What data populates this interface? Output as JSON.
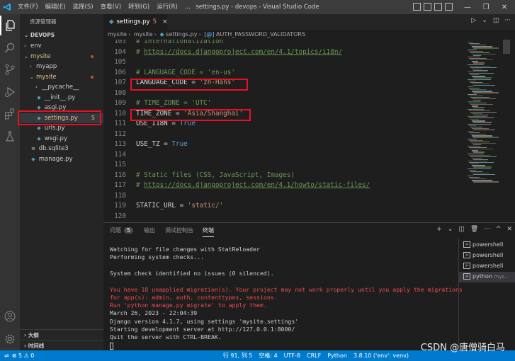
{
  "titlebar": {
    "menu": [
      "文件(F)",
      "编辑(E)",
      "选择(S)",
      "查看(V)",
      "转到(G)",
      "运行(R)",
      "..."
    ],
    "title": "settings.py - devops - Visual Studio Code",
    "controls": {
      "minimize": "—",
      "restore": "❐",
      "close": "✕"
    }
  },
  "activitybar": {
    "items": [
      "files-icon",
      "search-icon",
      "source-control-icon",
      "run-debug-icon",
      "extensions-icon",
      "testing-icon",
      "account-icon",
      "manage-gear-icon"
    ]
  },
  "sidebar": {
    "title": "资源管理器",
    "root": "DEVOPS",
    "tree": [
      {
        "label": "env",
        "type": "folder",
        "collapsed": true,
        "level": 1
      },
      {
        "label": "mysite",
        "type": "folder",
        "collapsed": false,
        "level": 1,
        "modified": true
      },
      {
        "label": "myapp",
        "type": "folder",
        "collapsed": true,
        "level": 2
      },
      {
        "label": "mysite",
        "type": "folder",
        "collapsed": false,
        "level": 2,
        "modified": true
      },
      {
        "label": "__pycache__",
        "type": "folder",
        "collapsed": true,
        "level": 3
      },
      {
        "label": "__init__.py",
        "type": "py",
        "level": 3
      },
      {
        "label": "asgi.py",
        "type": "py",
        "level": 3
      },
      {
        "label": "settings.py",
        "type": "py",
        "level": 3,
        "badge": "5",
        "selected": true
      },
      {
        "label": "urls.py",
        "type": "py",
        "level": 3
      },
      {
        "label": "wsgi.py",
        "type": "py",
        "level": 3
      },
      {
        "label": "db.sqlite3",
        "type": "db",
        "level": 2
      },
      {
        "label": "manage.py",
        "type": "py",
        "level": 2
      }
    ],
    "outline_label": "大纲",
    "timeline_label": "时间线"
  },
  "editor": {
    "tab": {
      "label": "settings.py",
      "problems": "5",
      "close": "×"
    },
    "breadcrumb": [
      "mysite",
      "mysite",
      "settings.py",
      "AUTH_PASSWORD_VALIDATORS"
    ],
    "lines": [
      {
        "n": "103",
        "tokens": [
          {
            "t": "# Internationalization",
            "c": "comment"
          }
        ]
      },
      {
        "n": "104",
        "tokens": [
          {
            "t": "# ",
            "c": "comment"
          },
          {
            "t": "https://docs.djangoproject.com/en/4.1/topics/i18n/",
            "c": "link"
          }
        ]
      },
      {
        "n": "105",
        "tokens": []
      },
      {
        "n": "106",
        "tokens": [
          {
            "t": "# LANGUAGE_CODE = 'en-us'",
            "c": "comment"
          }
        ]
      },
      {
        "n": "107",
        "tokens": [
          {
            "t": "LANGUAGE_CODE",
            "c": "var"
          },
          {
            "t": " = ",
            "c": "var"
          },
          {
            "t": "'zh-Hans'",
            "c": "str"
          }
        ]
      },
      {
        "n": "108",
        "tokens": []
      },
      {
        "n": "109",
        "tokens": [
          {
            "t": "# TIME_ZONE = 'UTC'",
            "c": "comment"
          }
        ]
      },
      {
        "n": "110",
        "tokens": [
          {
            "t": "TIME_ZONE",
            "c": "var"
          },
          {
            "t": " = ",
            "c": "var"
          },
          {
            "t": "'Asia/Shanghai'",
            "c": "str"
          }
        ]
      },
      {
        "n": "111",
        "tokens": [
          {
            "t": "USE_I18N",
            "c": "var"
          },
          {
            "t": " = ",
            "c": "var"
          },
          {
            "t": "True",
            "c": "kw"
          }
        ]
      },
      {
        "n": "112",
        "tokens": []
      },
      {
        "n": "113",
        "tokens": [
          {
            "t": "USE_TZ",
            "c": "var"
          },
          {
            "t": " = ",
            "c": "var"
          },
          {
            "t": "True",
            "c": "kw"
          }
        ]
      },
      {
        "n": "114",
        "tokens": []
      },
      {
        "n": "115",
        "tokens": []
      },
      {
        "n": "116",
        "tokens": [
          {
            "t": "# Static files (CSS, JavaScript, Images)",
            "c": "comment"
          }
        ]
      },
      {
        "n": "117",
        "tokens": [
          {
            "t": "# ",
            "c": "comment"
          },
          {
            "t": "https://docs.djangoproject.com/en/4.1/howto/static-files/",
            "c": "link"
          }
        ]
      },
      {
        "n": "118",
        "tokens": []
      },
      {
        "n": "119",
        "tokens": [
          {
            "t": "STATIC_URL",
            "c": "var"
          },
          {
            "t": " = ",
            "c": "var"
          },
          {
            "t": "'static/'",
            "c": "str"
          }
        ]
      },
      {
        "n": "120",
        "tokens": []
      }
    ]
  },
  "panel": {
    "tabs": [
      {
        "label": "问题",
        "count": "5"
      },
      {
        "label": "输出"
      },
      {
        "label": "调试控制台"
      },
      {
        "label": "终端",
        "active": true
      }
    ],
    "terminal_lines": [
      {
        "text": "Watching for file changes with StatReloader",
        "err": false
      },
      {
        "text": "Performing system checks...",
        "err": false
      },
      {
        "text": "",
        "err": false
      },
      {
        "text": "System check identified no issues (0 silenced).",
        "err": false
      },
      {
        "text": "",
        "err": false
      },
      {
        "text": "You have 18 unapplied migration(s). Your project may not work properly until you apply the migrations",
        "err": true
      },
      {
        "text": "for app(s): admin, auth, contenttypes, sessions.",
        "err": true
      },
      {
        "text": "Run 'python manage.py migrate' to apply them.",
        "err": true
      },
      {
        "text": "March 26, 2023 - 22:04:39",
        "err": false
      },
      {
        "text": "Django version 4.1.7, using settings 'mysite.settings'",
        "err": false
      },
      {
        "text": "Starting development server at http://127.0.0.1:8000/",
        "err": false
      },
      {
        "text": "Quit the server with CTRL-BREAK.",
        "err": false
      }
    ],
    "terminals": [
      {
        "label": "powershell",
        "sub": ""
      },
      {
        "label": "powershell",
        "sub": ""
      },
      {
        "label": "powershell",
        "sub": ""
      },
      {
        "label": "python",
        "sub": "mys...",
        "active": true
      }
    ]
  },
  "statusbar": {
    "problems": "⊗ 5 ⚠ 0",
    "position": "行 91, 列 5",
    "spaces": "空格: 4",
    "encoding": "UTF-8",
    "eol": "CRLF",
    "language": "Python",
    "interpreter": "3.8.10 ('env': venv)"
  },
  "watermark": "CSDN @唐僧骑白马",
  "colors": {
    "accent": "#007acc",
    "highlight_box": "#e81123"
  }
}
